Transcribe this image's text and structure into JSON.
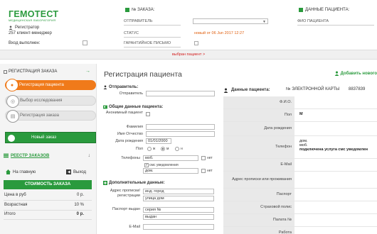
{
  "header": {
    "logo": "ГЕМОТЕСТ",
    "logo_sub": "МЕДИЦИНСКАЯ ЛАБОРАТОРИЯ",
    "user_role": "Регистратор",
    "user_sub": "257 клиент-менеджер",
    "login_label": "Вход выполнен:",
    "order_section": "№ ЗАКАЗА:",
    "sender_label": "ОТПРАВИТЕЛЬ",
    "status_label": "СТАТУС",
    "status_value": "новый от 06 Jun 2017 12:27",
    "warranty_label": "ГАРАНТИЙНОЕ ПИСЬМО",
    "patient_section": "ДАННЫЕ ПАЦИЕНТА:",
    "fio_label": "ФИО ПАЦИЕНТА",
    "patient_chosen": "выбран пациент >"
  },
  "sidebar": {
    "title": "РЕГИСТРАЦИЯ ЗАКАЗА",
    "steps": [
      {
        "label": "Регистрация пациента",
        "active": true
      },
      {
        "label": "Выбор исследования",
        "active": false
      },
      {
        "label": "Регистрация заказа",
        "active": false
      }
    ],
    "new_order": "Новый заказ",
    "registry": "РЕЕСТР ЗАКАЗОВ",
    "home": "На главную",
    "exit": "Выход",
    "cost_button": "СТОИМОСТЬ ЗАКАЗА",
    "summary": [
      {
        "label": "Цена в руб",
        "value": "0 р."
      },
      {
        "label": "Возрастная",
        "value": "10 %"
      },
      {
        "label": "Итого",
        "value": "0 р."
      }
    ]
  },
  "main": {
    "title": "Регистрация пациента",
    "add_new": "Добавить нового",
    "sender_section": "Отправитель:",
    "sender_label": "Отправитель",
    "general_section": "Общие данные пациента:",
    "anon_label": "Анонимный пациент",
    "surname_label": "Фамилия",
    "name_label": "Имя Отчество",
    "birth_label": "Дата рождения",
    "birth_value": "01/01/2000",
    "sex_label": "Пол",
    "sex_options": [
      "ж",
      "м",
      "н"
    ],
    "phones_label": "Телефоны",
    "phone_mob": "моб.",
    "phone_home": "дом.",
    "no_label": "нет",
    "sms_label": "смс уведомления",
    "extra_section": "Дополнительные данные:",
    "address_label": "Адрес прописки/ регистрации",
    "index_city": "инд. город",
    "street_house": "улица дом",
    "passport_label": "Паспорт выдан",
    "series_no": "серия №",
    "issued": "выдан",
    "email_label": "E-Mail"
  },
  "patient_data": {
    "title": "Данные пациента:",
    "card_label": "№ ЭЛЕКТРОННОЙ КАРТЫ",
    "card_no": "8837839",
    "rows": [
      {
        "label": "Ф.И.О.",
        "value": ""
      },
      {
        "label": "Пол",
        "value": "М"
      },
      {
        "label": "Дата рождения",
        "value": ""
      },
      {
        "label": "Телефон",
        "value": "дом.\nмоб.\nподключена услуга смс уведомлен"
      },
      {
        "label": "E-Mail",
        "value": ""
      },
      {
        "label": "Адрес прописки или проживания",
        "value": ""
      },
      {
        "label": "Паспорт",
        "value": ""
      },
      {
        "label": "Страховой полис",
        "value": ""
      },
      {
        "label": "Палата №",
        "value": ""
      },
      {
        "label": "Работа",
        "value": ""
      }
    ]
  },
  "colors": {
    "brand_green": "#2a9a3d",
    "active_orange": "#f07a1a",
    "status_orange": "#e06010",
    "alert_red": "#d42020"
  }
}
